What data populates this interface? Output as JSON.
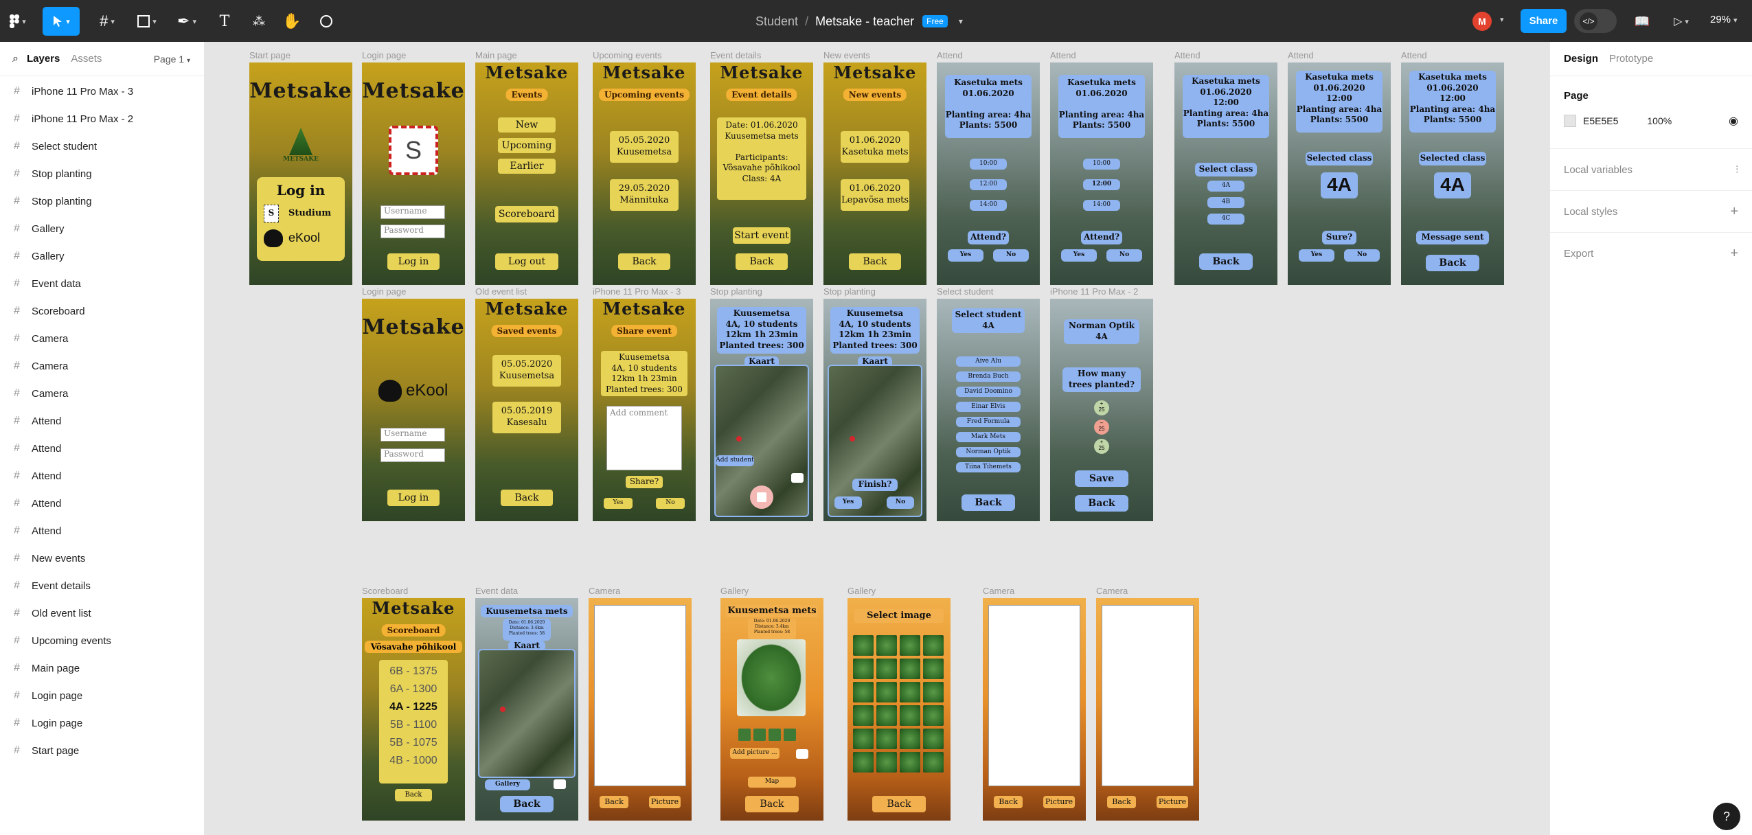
{
  "topbar": {
    "breadcrumb_project": "Student",
    "breadcrumb_sep": "/",
    "file_name": "Metsake - teacher",
    "plan_badge": "Free",
    "avatar_initial": "M",
    "share_label": "Share",
    "zoom": "29%"
  },
  "left_panel": {
    "tab_layers": "Layers",
    "tab_assets": "Assets",
    "page_select": "Page 1",
    "layers": [
      "iPhone 11 Pro Max - 3",
      "iPhone 11 Pro Max - 2",
      "Select student",
      "Stop planting",
      "Stop planting",
      "Gallery",
      "Gallery",
      "Event data",
      "Scoreboard",
      "Camera",
      "Camera",
      "Camera",
      "Attend",
      "Attend",
      "Attend",
      "Attend",
      "Attend",
      "New events",
      "Event details",
      "Old event list",
      "Upcoming events",
      "Main page",
      "Login page",
      "Login page",
      "Start page"
    ]
  },
  "right_panel": {
    "tab_design": "Design",
    "tab_prototype": "Prototype",
    "page_heading": "Page",
    "bg_color_hex": "E5E5E5",
    "bg_opacity": "100%",
    "local_variables": "Local variables",
    "local_styles": "Local styles",
    "export": "Export"
  },
  "frames": {
    "start": {
      "label": "Start page",
      "title": "Metsake",
      "logo": "METSAKE",
      "login": "Log in",
      "studium": "Studium",
      "studium_mark": "S",
      "ekool": "eKool"
    },
    "login1": {
      "label": "Login page",
      "title": "Metsake",
      "mark": "S",
      "username": "Username",
      "password": "Password",
      "button": "Log in"
    },
    "main": {
      "label": "Main page",
      "title": "Metsake",
      "tag": "Events",
      "items": [
        "New",
        "Upcoming",
        "Earlier"
      ],
      "scoreboard": "Scoreboard",
      "logout": "Log out"
    },
    "upcoming": {
      "label": "Upcoming events",
      "title": "Metsake",
      "tag": "Upcoming events",
      "e1": "05.05.2020\nKuusemetsa",
      "e2": "29.05.2020\nMännituka",
      "back": "Back"
    },
    "details": {
      "label": "Event details",
      "title": "Metsake",
      "tag": "Event details",
      "info": "Date: 01.06.2020\nKuusemetsa mets\n\nParticipants:\nVõsavahe põhikool\nClass: 4A",
      "start": "Start event",
      "back": "Back"
    },
    "newev": {
      "label": "New events",
      "title": "Metsake",
      "tag": "New events",
      "e1": "01.06.2020\nKasetuka mets",
      "e2": "01.06.2020\nLepavõsa mets",
      "back": "Back"
    },
    "attend1": {
      "label": "Attend",
      "info": "Kasetuka mets\n01.06.2020\n\nPlanting area: 4ha\nPlants: 5500",
      "times": [
        "10:00",
        "12:00",
        "14:00"
      ],
      "q": "Attend?",
      "yes": "Yes",
      "no": "No"
    },
    "attend2": {
      "label": "Attend",
      "info": "Kasetuka mets\n01.06.2020\n\nPlanting area: 4ha\nPlants: 5500",
      "times": [
        "10:00",
        "12:00",
        "14:00"
      ],
      "q": "Attend?",
      "yes": "Yes",
      "no": "No"
    },
    "attend3": {
      "label": "Attend",
      "info": "Kasetuka mets\n01.06.2020\n12:00\nPlanting area: 4ha\nPlants: 5500",
      "select": "Select class",
      "classes": [
        "4A",
        "4B",
        "4C"
      ],
      "back": "Back"
    },
    "attend4": {
      "label": "Attend",
      "info": "Kasetuka mets\n01.06.2020\n12:00\nPlanting area: 4ha\nPlants: 5500",
      "selected": "Selected class",
      "cls": "4A",
      "q": "Sure?",
      "yes": "Yes",
      "no": "No"
    },
    "attend5": {
      "label": "Attend",
      "info": "Kasetuka mets\n01.06.2020\n12:00\nPlanting area: 4ha\nPlants: 5500",
      "selected": "Selected class",
      "cls": "4A",
      "sent": "Message sent",
      "back": "Back"
    },
    "login2": {
      "label": "Login page",
      "title": "Metsake",
      "ekool": "eKool",
      "username": "Username",
      "password": "Password",
      "button": "Log in"
    },
    "oldlist": {
      "label": "Old event list",
      "title": "Metsake",
      "tag": "Saved events",
      "e1": "05.05.2020\nKuusemetsa",
      "e2": "05.05.2019\nKasesalu",
      "back": "Back"
    },
    "share": {
      "label": "iPhone 11 Pro Max - 3",
      "title": "Metsake",
      "tag": "Share event",
      "info": "Kuusemetsa\n4A, 10 students\n12km 1h 23min\nPlanted trees: 300",
      "comment": "Add comment",
      "q": "Share?",
      "yes": "Yes",
      "no": "No"
    },
    "stop1": {
      "label": "Stop planting",
      "info": "Kuusemetsa\n4A, 10 students\n12km 1h 23min\nPlanted trees: 300",
      "kaart": "Kaart",
      "add": "Add student"
    },
    "stop2": {
      "label": "Stop planting",
      "info": "Kuusemetsa\n4A, 10 students\n12km 1h 23min\nPlanted trees: 300",
      "kaart": "Kaart",
      "q": "Finish?",
      "yes": "Yes",
      "no": "No"
    },
    "selstudent": {
      "label": "Select student",
      "head": "Select student\n4A",
      "students": [
        "Aive Alu",
        "Brenda Buch",
        "David Doomino",
        "Einar Elvis",
        "Fred Formula",
        "Mark Mets",
        "Norman Optik",
        "Tiina Tihemets"
      ],
      "back": "Back"
    },
    "iph2": {
      "label": "iPhone 11 Pro Max - 2",
      "head": "Norman Optik\n4A",
      "q": "How many\ntrees planted?",
      "plus": "+",
      "val": "25",
      "minus": "–",
      "save": "Save",
      "back": "Back"
    },
    "scoreboard": {
      "label": "Scoreboard",
      "title": "Metsake",
      "tag": "Scoreboard",
      "school": "Võsavahe põhikool",
      "rows": [
        "6B - 1375",
        "6A - 1300",
        "4A - 1225",
        "5B - 1100",
        "5B - 1075",
        "4B - 1000"
      ],
      "back": "Back"
    },
    "eventdata": {
      "label": "Event data",
      "head": "Kuusemetsa mets",
      "sub": "Date: 01.06.2020\nDistance: 3.4km\nPlanted trees: 58",
      "kaart": "Kaart",
      "gallery": "Gallery",
      "back": "Back"
    },
    "camera1": {
      "label": "Camera",
      "back": "Back",
      "picture": "Picture"
    },
    "gallery1": {
      "label": "Gallery",
      "head": "Kuusemetsa mets",
      "sub": "Date: 01.06.2020\nDistance: 3.4km\nPlanted trees: 58",
      "add": "Add picture ...",
      "map": "Map",
      "back": "Back"
    },
    "gallery2": {
      "label": "Gallery",
      "head": "Select image",
      "back": "Back"
    },
    "camera2": {
      "label": "Camera",
      "back": "Back",
      "picture": "Picture"
    },
    "camera3": {
      "label": "Camera",
      "back": "Back",
      "picture": "Picture"
    }
  }
}
